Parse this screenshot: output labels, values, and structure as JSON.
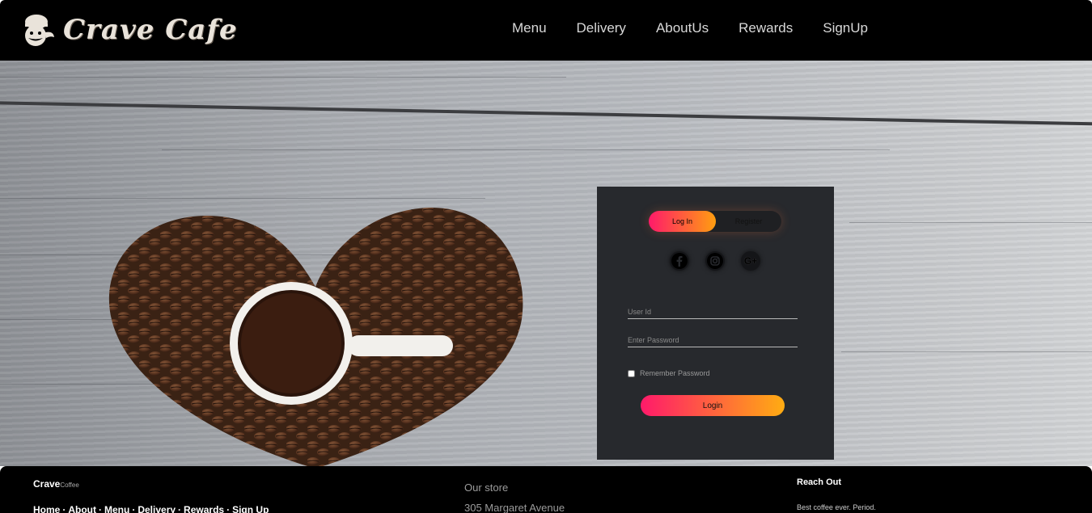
{
  "header": {
    "logo_text": "Crave Cafe",
    "nav": [
      "Menu",
      "Delivery",
      "AboutUs",
      "Rewards",
      "SignUp"
    ]
  },
  "login_card": {
    "tab_login": "Log In",
    "tab_register": "Register",
    "social_icons": [
      "facebook-icon",
      "instagram-icon",
      "google-plus-icon"
    ],
    "google_plus_glyph": "G+",
    "user_id_placeholder": "User Id",
    "password_placeholder": "Enter Password",
    "remember_label": "Remember Password",
    "login_button": "Login",
    "accent_start": "#ff1a6a",
    "accent_end": "#ffac12"
  },
  "footer": {
    "brand_bold": "Crave",
    "brand_small": "Coffee",
    "links": [
      "Home",
      "About",
      "Menu",
      "Delivery",
      "Rewards",
      "Sign Up"
    ],
    "link_separator": "·",
    "store_title": "Our store",
    "store_address": "305 Margaret Avenue",
    "reach_title": "Reach Out",
    "tagline": "Best coffee ever. Period."
  }
}
